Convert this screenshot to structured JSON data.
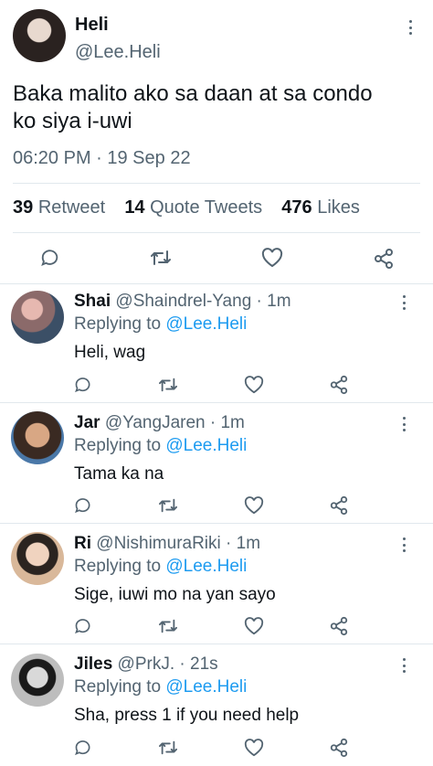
{
  "tweet": {
    "name": "Heli",
    "handle": "@Lee.Heli",
    "text_line1": "Baka malito ako sa daan at sa condo",
    "text_line2": "ko siya i-uwi",
    "time": "06:20 PM · 19 Sep 22",
    "retweets_count": "39",
    "retweets_label": "Retweet",
    "quotes_count": "14",
    "quotes_label": "Quote Tweets",
    "likes_count": "476",
    "likes_label": "Likes"
  },
  "replies": [
    {
      "name": "Shai",
      "handle": "@Shaindrel-Yang",
      "time": "· 1m",
      "replying_label": "Replying to",
      "replying_to": "@Lee.Heli",
      "text": "Heli, wag"
    },
    {
      "name": "Jar",
      "handle": "@YangJaren",
      "time": "· 1m",
      "replying_label": "Replying to",
      "replying_to": "@Lee.Heli",
      "text": "Tama ka na"
    },
    {
      "name": "Ri",
      "handle": "@NishimuraRiki",
      "time": "· 1m",
      "replying_label": "Replying to",
      "replying_to": "@Lee.Heli",
      "text": "Sige, iuwi mo na yan sayo"
    },
    {
      "name": "Jiles",
      "handle": "@PrkJ.",
      "time": "· 21s",
      "replying_label": "Replying to",
      "replying_to": "@Lee.Heli",
      "text": "Sha, press 1 if you need help"
    }
  ],
  "icons": {
    "reply": "speech-bubble-icon",
    "retweet": "retweet-arrows-icon",
    "like": "heart-icon",
    "share": "share-nodes-icon",
    "more": "vertical-dots-icon"
  },
  "colors": {
    "text": "#0f1419",
    "muted": "#536471",
    "link": "#1d9bf0",
    "divider": "#e1e8ed"
  }
}
